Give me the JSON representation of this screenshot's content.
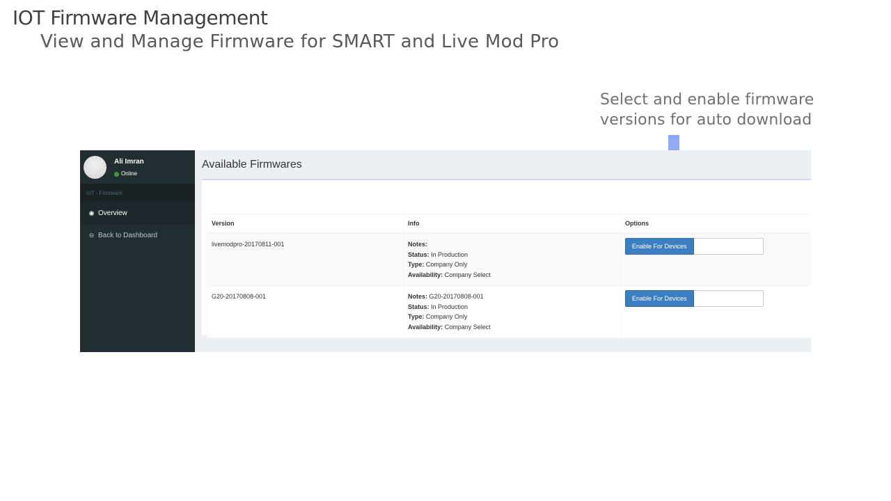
{
  "slide": {
    "title": "IOT Firmware Management",
    "subtitle": "View and Manage Firmware for SMART and Live Mod Pro",
    "callout": "Select and enable firmware versions for auto download",
    "arrow_color": "#8eaaf7"
  },
  "sidebar": {
    "user_name": "Ali Imran",
    "user_status": "Online",
    "menu_header": "IoT - Firmware",
    "items": [
      {
        "icon": "eye-icon",
        "label": "Overview",
        "active": true
      },
      {
        "icon": "circle-arrow-left-icon",
        "label": "Back to Dashboard",
        "active": false
      }
    ],
    "bg_color": "#222d32"
  },
  "main": {
    "heading": "Available Firmwares",
    "table": {
      "headers": [
        "Version",
        "Info",
        "Options"
      ],
      "labels": {
        "notes": "Notes:",
        "status": "Status:",
        "type": "Type:",
        "availability": "Availability:"
      },
      "rows": [
        {
          "version": "livemodpro-20170811-001",
          "notes": "",
          "status": "In Production",
          "type": "Company Only",
          "availability": "Company Select",
          "button": "Enable For Devices",
          "input_value": ""
        },
        {
          "version": "G20-20170808-001",
          "notes": "G20-20170808-001",
          "status": "In Production",
          "type": "Company Only",
          "availability": "Company Select",
          "button": "Enable For Devices",
          "input_value": ""
        }
      ]
    },
    "button_color": "#3c7fc1"
  }
}
